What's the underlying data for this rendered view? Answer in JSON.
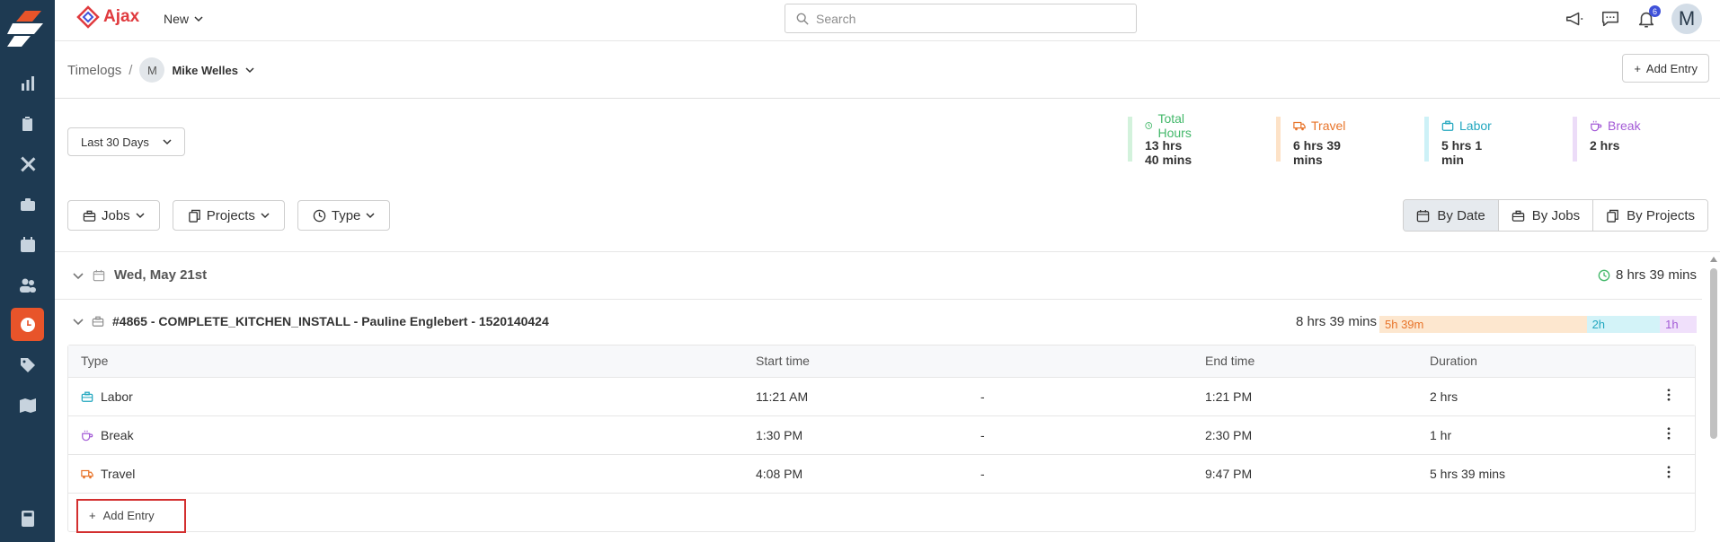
{
  "app": {
    "brand": "Ajax",
    "new_label": "New"
  },
  "search": {
    "placeholder": "Search"
  },
  "notifications": {
    "count": "6"
  },
  "user_avatar": "M",
  "breadcrumb": {
    "root": "Timelogs",
    "separator": "/",
    "user_initial": "M",
    "user_name": "Mike Welles"
  },
  "header": {
    "add_entry": "Add Entry"
  },
  "date_range": "Last 30 Days",
  "stats": {
    "total": {
      "label": "Total Hours",
      "value": "13 hrs 40 mins",
      "color": "#43b86a"
    },
    "travel": {
      "label": "Travel",
      "value": "6 hrs 39 mins",
      "color": "#e8742a"
    },
    "labor": {
      "label": "Labor",
      "value": "5 hrs 1 min",
      "color": "#22a7bf"
    },
    "break": {
      "label": "Break",
      "value": "2 hrs",
      "color": "#a35ad6"
    }
  },
  "filters": {
    "jobs": "Jobs",
    "projects": "Projects",
    "type": "Type"
  },
  "views": {
    "by_date": "By Date",
    "by_jobs": "By Jobs",
    "by_projects": "By Projects",
    "active": "by_date"
  },
  "date_group": {
    "label": "Wed, May 21st",
    "total": "8 hrs 39 mins"
  },
  "job_group": {
    "label": "#4865 - COMPLETE_KITCHEN_INSTALL - Pauline Englebert - 1520140424",
    "total": "8 hrs 39 mins",
    "segments": [
      {
        "label": "5h 39m",
        "color": "#fde7cf",
        "text_color": "#e8742a",
        "hours": 5.65
      },
      {
        "label": "2h",
        "color": "#d3f3f8",
        "text_color": "#22a7bf",
        "hours": 2
      },
      {
        "label": "1h",
        "color": "#f0e0fb",
        "text_color": "#a35ad6",
        "hours": 1
      }
    ]
  },
  "table": {
    "headers": {
      "type": "Type",
      "start": "Start time",
      "end": "End time",
      "duration": "Duration"
    },
    "rows": [
      {
        "type": "Labor",
        "start": "11:21 AM",
        "dash": "-",
        "end": "1:21 PM",
        "duration": "2 hrs"
      },
      {
        "type": "Break",
        "start": "1:30 PM",
        "dash": "-",
        "end": "2:30 PM",
        "duration": "1 hr"
      },
      {
        "type": "Travel",
        "start": "4:08 PM",
        "dash": "-",
        "end": "9:47 PM",
        "duration": "5 hrs 39 mins"
      }
    ],
    "add_entry": "Add Entry"
  }
}
